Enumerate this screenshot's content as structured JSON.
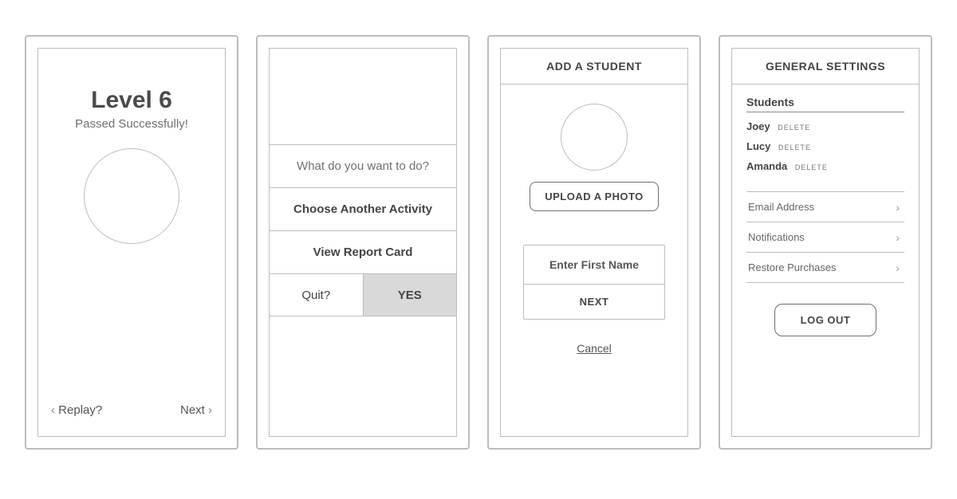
{
  "screen1": {
    "title": "Level 6",
    "subtitle": "Passed Successfully!",
    "replay": "Replay?",
    "next": "Next"
  },
  "screen2": {
    "prompt": "What do you want to do?",
    "choose": "Choose Another Activity",
    "report": "View Report Card",
    "quit": "Quit?",
    "yes": "YES"
  },
  "screen3": {
    "title": "ADD A STUDENT",
    "upload": "UPLOAD A PHOTO",
    "placeholder": "Enter First Name",
    "next": "NEXT",
    "cancel": "Cancel"
  },
  "screen4": {
    "title": "GENERAL SETTINGS",
    "students_label": "Students",
    "delete": "DELETE",
    "students": [
      {
        "name": "Joey"
      },
      {
        "name": "Lucy"
      },
      {
        "name": "Amanda"
      }
    ],
    "email": "Email Address",
    "notifications": "Notifications",
    "restore": "Restore Purchases",
    "logout": "LOG OUT"
  }
}
